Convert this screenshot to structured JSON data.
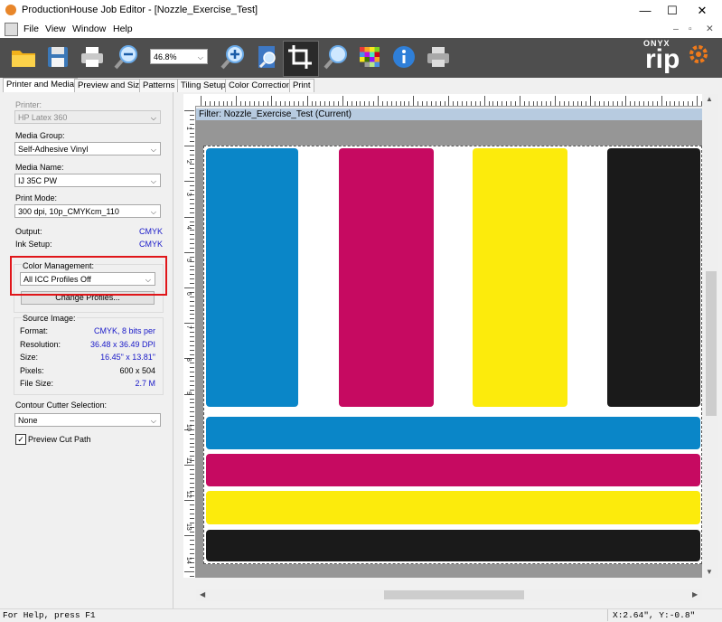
{
  "window": {
    "title": "ProductionHouse Job Editor - [Nozzle_Exercise_Test]",
    "minimize": "—",
    "maximize": "☐",
    "close": "✕"
  },
  "menu": {
    "items": [
      "File",
      "View",
      "Window",
      "Help"
    ],
    "mdi_controls": [
      "–",
      "▫",
      "✕"
    ]
  },
  "toolbar": {
    "zoom_value": "46.8%",
    "brand_top": "ONYX",
    "brand_bottom": "rip"
  },
  "tabs": [
    "Printer and Media",
    "Preview and Size",
    "Patterns",
    "Tiling Setup",
    "Color Correction",
    "Print"
  ],
  "panel": {
    "printer_label": "Printer:",
    "printer_value": "HP Latex 360",
    "media_group_label": "Media Group:",
    "media_group_value": "Self-Adhesive Vinyl",
    "media_name_label": "Media Name:",
    "media_name_value": "IJ 35C PW",
    "print_mode_label": "Print Mode:",
    "print_mode_value": "300 dpi, 10p_CMYKcm_110",
    "output_label": "Output:",
    "output_value": "CMYK",
    "ink_setup_label": "Ink Setup:",
    "ink_setup_value": "CMYK",
    "color_mgmt_label": "Color Management:",
    "color_mgmt_value": "All ICC Profiles Off",
    "change_profiles_label": "Change Profiles...",
    "source_image_label": "Source Image:",
    "format_label": "Format:",
    "format_value": "CMYK, 8 bits per",
    "resolution_label": "Resolution:",
    "resolution_value": "36.48 x 36.49 DPI",
    "size_label": "Size:",
    "size_value": "16.45\" x 13.81\"",
    "pixels_label": "Pixels:",
    "pixels_value": "600 x 504",
    "filesize_label": "File Size:",
    "filesize_value": "2.7 M",
    "contour_label": "Contour Cutter Selection:",
    "contour_value": "None",
    "preview_cut_label": "Preview Cut Path",
    "preview_cut_checked": true
  },
  "canvas": {
    "filter_label": "Filter: Nozzle_Exercise_Test (Current)",
    "ruler_numbers": [
      "1",
      "2",
      "3",
      "4",
      "5",
      "6",
      "7",
      "8",
      "9",
      "10",
      "11",
      "12",
      "13",
      "14"
    ],
    "colors": {
      "cyan": "#0a86c8",
      "magenta": "#c60a61",
      "yellow": "#fceb0c",
      "black": "#1a1a1a"
    }
  },
  "status": {
    "help": "For Help, press F1",
    "coords": "X:2.64\", Y:-0.8\""
  },
  "highlight_color": "#e0161a"
}
